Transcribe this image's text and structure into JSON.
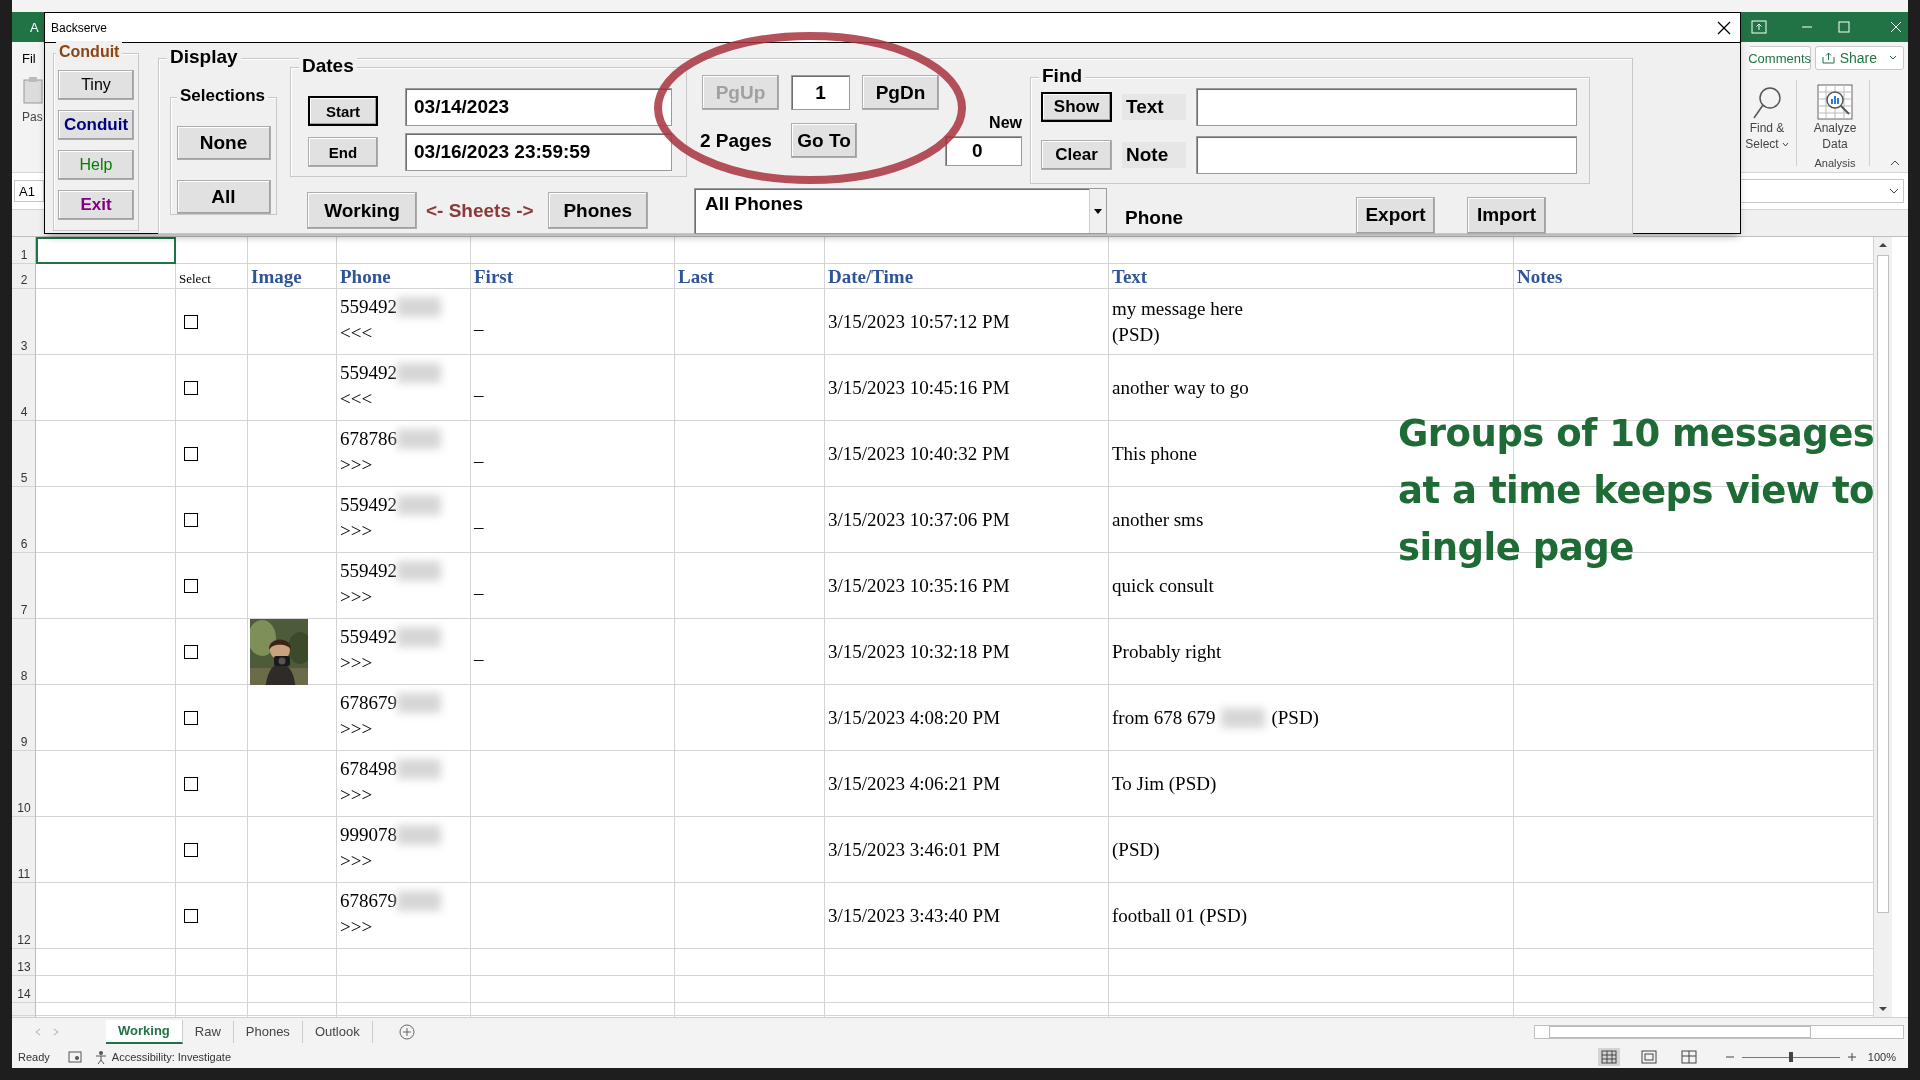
{
  "excel": {
    "app_cut": "A",
    "tab_cut": "Fil",
    "paste_cut": "Pas",
    "name_box": "A1",
    "comments": "Comments",
    "share": "Share",
    "find_select": [
      "Find &",
      "Select"
    ],
    "analyze": [
      "Analyze",
      "Data"
    ],
    "group_label": "Analysis"
  },
  "dialog": {
    "title": "Backserve",
    "conduit": {
      "label": "Conduit",
      "buttons": [
        {
          "label": "Tiny",
          "color": "#000000"
        },
        {
          "label": "Conduit",
          "color": "#000080"
        },
        {
          "label": "Help",
          "color": "#008000"
        },
        {
          "label": "Exit",
          "color": "#800080"
        }
      ]
    },
    "display": {
      "label": "Display",
      "selections": {
        "label": "Selections",
        "buttons": [
          "None",
          "All"
        ]
      },
      "dates": {
        "label": "Dates",
        "start_button": "Start",
        "end_button": "End",
        "start_value": "03/14/2023",
        "end_value": "03/16/2023 23:59:59"
      },
      "sheets": {
        "left_button": "Working",
        "label": "<- Sheets ->",
        "right_button": "Phones"
      },
      "pager": {
        "pgup": {
          "label": "PgUp",
          "disabled": true
        },
        "page": "1",
        "pgdn": {
          "label": "PgDn",
          "disabled": false
        },
        "pages": "2 Pages",
        "goto": "Go To"
      },
      "new": {
        "label": "New",
        "value": "0"
      },
      "find": {
        "label": "Find",
        "show": "Show",
        "clear": "Clear",
        "text_label": "Text",
        "note_label": "Note"
      },
      "phone_select": {
        "value": "All Phones"
      },
      "phone_label": "Phone",
      "export": "Export",
      "import": "Import"
    }
  },
  "sheet": {
    "row_numbers": [
      "1",
      "2",
      "3",
      "4",
      "5",
      "6",
      "7",
      "8",
      "9",
      "10",
      "11",
      "12",
      "13",
      "14"
    ],
    "select_header": "Select",
    "headers": [
      "Image",
      "Phone",
      "First",
      "Last",
      "Date/Time",
      "Text",
      "Notes"
    ],
    "rows": [
      {
        "checked": false,
        "phone": "559492",
        "direction": "<<<",
        "first": "–",
        "datetime": "3/15/2023 10:57:12 PM",
        "text": [
          "my message here\n(PSD)"
        ]
      },
      {
        "checked": false,
        "phone": "559492",
        "direction": "<<<",
        "first": "–",
        "datetime": "3/15/2023 10:45:16 PM",
        "text": [
          "another way to go\n"
        ]
      },
      {
        "checked": false,
        "phone": "678786",
        "direction": ">>>",
        "first": "–",
        "datetime": "3/15/2023 10:40:32 PM",
        "text": [
          "This phone"
        ]
      },
      {
        "checked": false,
        "phone": "559492",
        "direction": ">>>",
        "first": "–",
        "datetime": "3/15/2023 10:37:06 PM",
        "text": [
          "another sms"
        ]
      },
      {
        "checked": false,
        "phone": "559492",
        "direction": ">>>",
        "first": "–",
        "datetime": "3/15/2023 10:35:16 PM",
        "text": [
          "quick consult"
        ]
      },
      {
        "checked": false,
        "image": {
          "kind": "picture"
        },
        "phone": "559492",
        "direction": ">>>",
        "first": "–",
        "datetime": "3/15/2023 10:32:18 PM",
        "text": [
          "Probably right"
        ]
      },
      {
        "checked": false,
        "phone": "678679",
        "direction": ">>>",
        "datetime": "3/15/2023 4:08:20 PM",
        "text": [
          "from 678 679",
          "(PSD)"
        ]
      },
      {
        "checked": false,
        "phone": "678498",
        "direction": ">>>",
        "datetime": "3/15/2023 4:06:21 PM",
        "text": [
          "To Jim (PSD)"
        ]
      },
      {
        "checked": false,
        "phone": "999078",
        "direction": ">>>",
        "datetime": "3/15/2023 3:46:01 PM",
        "text": [
          "(PSD)"
        ]
      },
      {
        "checked": false,
        "phone": "678679",
        "direction": ">>>",
        "datetime": "3/15/2023 3:43:40 PM",
        "text": [
          "football 01 (PSD)"
        ]
      }
    ],
    "tabs": [
      {
        "label": "Working",
        "selected": true
      },
      {
        "label": "Raw",
        "selected": false
      },
      {
        "label": "Phones",
        "selected": false
      },
      {
        "label": "Outlook",
        "selected": false
      }
    ]
  },
  "status_bar": {
    "ready": "Ready",
    "accessibility": "Accessibility: Investigate",
    "views": [
      {
        "kind": "normal",
        "selected": true
      },
      {
        "kind": "layout",
        "selected": false
      },
      {
        "kind": "pagebreak",
        "selected": false
      }
    ],
    "zoom": {
      "level": 0.5,
      "reading": "100%"
    }
  },
  "annotation": {
    "text": "Groups of 10 messages at a time keeps view to single page"
  }
}
